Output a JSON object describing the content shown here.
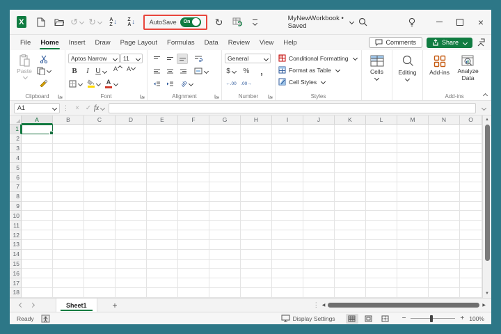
{
  "colors": {
    "accent_green": "#107c41",
    "frame_teal": "#2d7787",
    "highlight_red": "#e8453c"
  },
  "titlebar": {
    "app": "X",
    "autosave_label": "AutoSave",
    "autosave_state": "On",
    "workbook_title": "MyNewWorkbook • Saved",
    "glyphs": {
      "undo": "↺",
      "redo": "↻",
      "refresh": "↻",
      "sort_a": "A",
      "sort_z": "Z",
      "sort_arrow": "↓",
      "close": "×"
    }
  },
  "menubar": {
    "tabs": [
      {
        "label": "File"
      },
      {
        "label": "Home",
        "active": true
      },
      {
        "label": "Insert"
      },
      {
        "label": "Draw"
      },
      {
        "label": "Page Layout"
      },
      {
        "label": "Formulas"
      },
      {
        "label": "Data"
      },
      {
        "label": "Review"
      },
      {
        "label": "View"
      },
      {
        "label": "Help"
      }
    ],
    "comments_label": "Comments",
    "share_label": "Share"
  },
  "ribbon": {
    "clipboard": {
      "label": "Clipboard",
      "paste_label": "Paste"
    },
    "font": {
      "label": "Font",
      "font_name": "Aptos Narrow",
      "font_size": "11",
      "bold": "B",
      "italic": "I",
      "underline": "U",
      "grow": "A",
      "shrink": "A",
      "font_color_letter": "A"
    },
    "alignment": {
      "label": "Alignment",
      "orientation": "ab"
    },
    "number": {
      "label": "Number",
      "format": "General",
      "currency": "$",
      "percent": "%",
      "comma": ",",
      "inc_decimal": "←.00",
      "dec_decimal": ".00→"
    },
    "styles": {
      "label": "Styles",
      "items": [
        {
          "label": "Conditional Formatting"
        },
        {
          "label": "Format as Table"
        },
        {
          "label": "Cell Styles"
        }
      ]
    },
    "cells_label": "Cells",
    "editing_label": "Editing",
    "addins": {
      "group_label": "Add-ins",
      "addins_label": "Add-ins",
      "analyze_line1": "Analyze",
      "analyze_line2": "Data"
    }
  },
  "formula_bar": {
    "name_box": "A1",
    "dots": "⋮",
    "cancel": "×",
    "enter": "✓",
    "fx": "fx",
    "value": ""
  },
  "grid": {
    "columns": [
      "A",
      "B",
      "C",
      "D",
      "E",
      "F",
      "G",
      "H",
      "I",
      "J",
      "K",
      "L",
      "M",
      "N",
      "O"
    ],
    "rows": [
      "1",
      "2",
      "3",
      "4",
      "5",
      "6",
      "7",
      "8",
      "9",
      "10",
      "11",
      "12",
      "13",
      "14",
      "15",
      "16",
      "17",
      "18"
    ],
    "selected_cell": "A1",
    "scroll_glyphs": {
      "up": "▲",
      "down": "▼",
      "left": "◀",
      "right": "▶",
      "dots": "⋮"
    }
  },
  "sheet_bar": {
    "active_tab": "Sheet1",
    "add_sheet": "+"
  },
  "status_bar": {
    "mode": "Ready",
    "display_settings": "Display Settings",
    "zoom_minus": "−",
    "zoom_plus": "+",
    "zoom_level": "100%"
  }
}
